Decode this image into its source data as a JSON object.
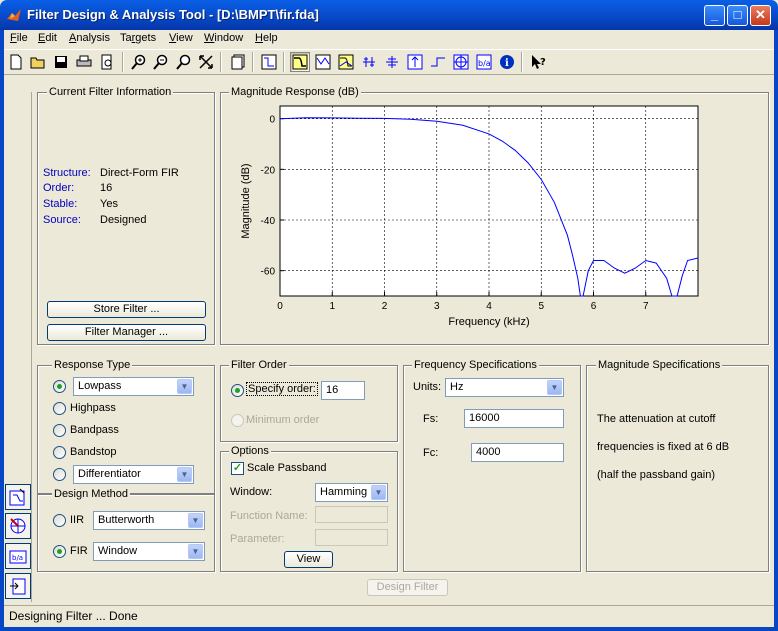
{
  "window": {
    "title": "Filter Design & Analysis Tool -  [D:\\BMPT\\fir.fda]"
  },
  "menu": [
    "File",
    "Edit",
    "Analysis",
    "Targets",
    "View",
    "Window",
    "Help"
  ],
  "menu_underline": [
    "F",
    "E",
    "A",
    "r",
    "V",
    "W",
    "H"
  ],
  "toolbar_icons": [
    "new-icon",
    "open-icon",
    "save-icon",
    "print-icon",
    "print-preview-icon",
    "zoom-in-icon",
    "zoom-out-icon",
    "zoom-x-icon",
    "full-view-icon",
    "new-figure-icon",
    "filter-specs-icon",
    "magnitude-response-icon",
    "phase-response-icon",
    "magnitude-phase-icon",
    "group-delay-icon",
    "phase-delay-icon",
    "impulse-response-icon",
    "step-response-icon",
    "pole-zero-icon",
    "coefficients-icon",
    "filter-info-icon",
    "whats-this-icon"
  ],
  "current_filter": {
    "title": "Current Filter Information",
    "rows": [
      {
        "label": "Structure:",
        "value": "Direct-Form FIR"
      },
      {
        "label": "Order:",
        "value": "16"
      },
      {
        "label": "Stable:",
        "value": "Yes"
      },
      {
        "label": "Source:",
        "value": "Designed"
      }
    ],
    "store_button": "Store Filter ...",
    "manager_button": "Filter Manager ..."
  },
  "plot": {
    "title": "Magnitude Response (dB)",
    "y_label": "Magnitude (dB)",
    "x_label": "Frequency (kHz)"
  },
  "chart_data": {
    "type": "line",
    "xlabel": "Frequency (kHz)",
    "ylabel": "Magnitude (dB)",
    "xlim": [
      0,
      8
    ],
    "ylim": [
      -70,
      5
    ],
    "xticks": [
      0,
      1,
      2,
      3,
      4,
      5,
      6,
      7
    ],
    "yticks": [
      0,
      -20,
      -40,
      -60
    ],
    "grid": true,
    "color": "#0000ff",
    "x": [
      0,
      0.5,
      1,
      1.5,
      2,
      2.5,
      3,
      3.5,
      4,
      4.25,
      4.5,
      4.75,
      5,
      5.25,
      5.5,
      5.6,
      5.7,
      5.75,
      5.8,
      5.9,
      6,
      6.2,
      6.4,
      6.6,
      6.8,
      7,
      7.2,
      7.4,
      7.5,
      7.6,
      7.7,
      7.8,
      8
    ],
    "y": [
      0,
      0.4,
      0.3,
      0.2,
      0.1,
      -0.2,
      -1,
      -2.6,
      -6,
      -8.8,
      -12.5,
      -17.5,
      -24,
      -33,
      -46,
      -54,
      -63,
      -70,
      -70,
      -60,
      -56,
      -56,
      -59,
      -61,
      -59,
      -56,
      -57,
      -63,
      -70,
      -70,
      -62,
      -56,
      -55
    ]
  },
  "response_type": {
    "title": "Response Type",
    "options": [
      "Lowpass",
      "Highpass",
      "Bandpass",
      "Bandstop",
      "Differentiator"
    ],
    "selected": "Lowpass"
  },
  "design_method": {
    "title": "Design Method",
    "iir_label": "IIR",
    "iir_value": "Butterworth",
    "fir_label": "FIR",
    "fir_value": "Window"
  },
  "filter_order": {
    "title": "Filter Order",
    "specify_label": "Specify order:",
    "order_value": "16",
    "minimum_label": "Minimum order"
  },
  "options": {
    "title": "Options",
    "scale_passband": "Scale Passband",
    "window_label": "Window:",
    "window_value": "Hamming",
    "function_label": "Function Name:",
    "parameter_label": "Parameter:",
    "view_button": "View"
  },
  "freq_specs": {
    "title": "Frequency Specifications",
    "units_label": "Units:",
    "units_value": "Hz",
    "fs_label": "Fs:",
    "fs_value": "16000",
    "fc_label": "Fc:",
    "fc_value": "4000"
  },
  "mag_specs": {
    "title": "Magnitude Specifications",
    "line1": "The attenuation at cutoff",
    "line2": "frequencies is fixed at 6 dB",
    "line3": "(half the passband gain)"
  },
  "design_button": "Design Filter",
  "status": "Designing Filter ... Done",
  "side_icons": [
    "transform-filter-icon",
    "pole-zero-editor-icon",
    "realize-model-icon",
    "import-filter-icon"
  ]
}
